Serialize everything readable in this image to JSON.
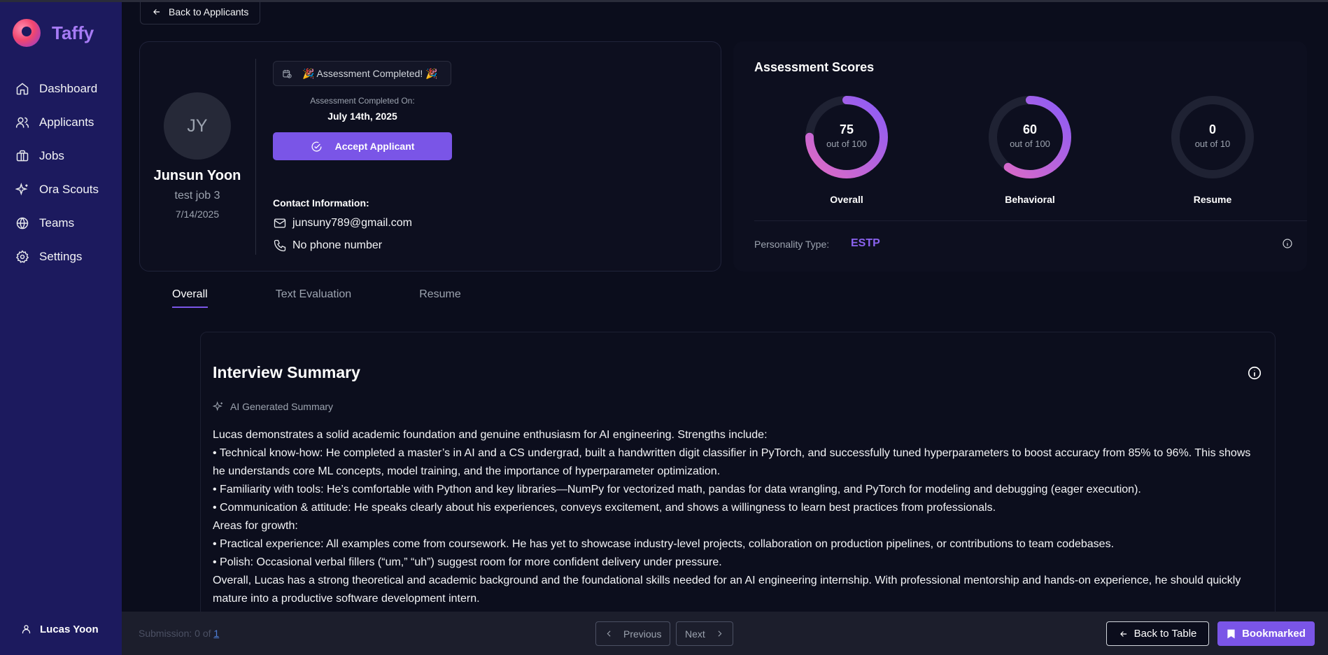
{
  "app": {
    "name": "Taffy"
  },
  "sidebar": {
    "items": [
      {
        "label": "Dashboard",
        "icon": "home-icon"
      },
      {
        "label": "Applicants",
        "icon": "users-icon"
      },
      {
        "label": "Jobs",
        "icon": "briefcase-icon"
      },
      {
        "label": "Ora Scouts",
        "icon": "sparkles-icon"
      },
      {
        "label": "Teams",
        "icon": "globe-icon"
      },
      {
        "label": "Settings",
        "icon": "gear-icon"
      }
    ],
    "user": "Lucas Yoon"
  },
  "back_label": "Back to Applicants",
  "profile": {
    "initials": "JY",
    "name": "Junsun Yoon",
    "job": "test job 3",
    "date": "7/14/2025",
    "badge": "🎉 Assessment Completed! 🎉",
    "completed_on_label": "Assessment Completed On:",
    "completed_on_date": "July 14th, 2025",
    "accept_label": "Accept Applicant",
    "contact_title": "Contact Information:",
    "email": "junsuny789@gmail.com",
    "phone": "No phone number"
  },
  "scores": {
    "title": "Assessment Scores",
    "items": [
      {
        "value": "75",
        "max_label": "out of 100",
        "label": "Overall",
        "fraction": 0.75
      },
      {
        "value": "60",
        "max_label": "out of 100",
        "label": "Behavioral",
        "fraction": 0.6
      },
      {
        "value": "0",
        "max_label": "out of 10",
        "label": "Resume",
        "fraction": 0
      }
    ],
    "personality_label": "Personality Type:",
    "personality_value": "ESTP"
  },
  "tabs": [
    {
      "label": "Overall",
      "active": true
    },
    {
      "label": "Text Evaluation",
      "active": false
    },
    {
      "label": "Resume",
      "active": false
    }
  ],
  "summary": {
    "title": "Interview Summary",
    "ai_label": "AI Generated Summary",
    "lines": [
      "Lucas demonstrates a solid academic foundation and genuine enthusiasm for AI engineering. Strengths include:",
      "• Technical know-how: He completed a master’s in AI and a CS undergrad, built a handwritten digit classifier in PyTorch, and successfully tuned hyperparameters to boost accuracy from 85% to 96%. This shows he understands core ML concepts, model training, and the importance of hyperparameter optimization.",
      "• Familiarity with tools: He’s comfortable with Python and key libraries—NumPy for vectorized math, pandas for data wrangling, and PyTorch for modeling and debugging (eager execution).",
      "• Communication & attitude: He speaks clearly about his experiences, conveys excitement, and shows a willingness to learn best practices from professionals.",
      "Areas for growth:",
      "• Practical experience: All examples come from coursework. He has yet to showcase industry-level projects, collaboration on production pipelines, or contributions to team codebases.",
      "• Polish: Occasional verbal fillers (“um,” “uh”) suggest room for more confident delivery under pressure.",
      "Overall, Lucas has a strong theoretical and academic background and the foundational skills needed for an AI engineering internship. With professional mentorship and hands-on experience, he should quickly mature into a productive software development intern."
    ]
  },
  "footer": {
    "submission_prefix": "Submission: 0 of ",
    "submission_total": "1",
    "previous_label": "Previous",
    "next_label": "Next",
    "back_table_label": "Back to Table",
    "bookmark_label": "Bookmarked"
  },
  "colors": {
    "accent": "#7a55e7",
    "sidebar": "#1c1a5e",
    "ring_start": "#8b5cf6",
    "ring_end": "#e06bc4",
    "ring_track": "#1f2233"
  }
}
